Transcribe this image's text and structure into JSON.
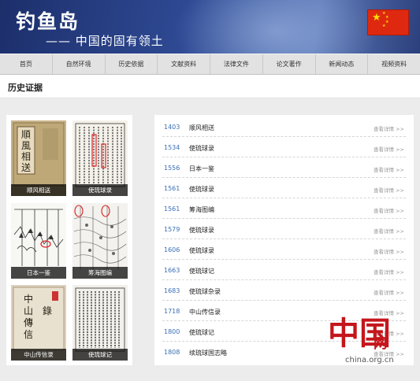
{
  "header": {
    "title": "钓鱼岛",
    "subtitle": "—— 中国的固有领土",
    "flag_icon": "china-flag"
  },
  "nav": [
    "首页",
    "自然环境",
    "历史依据",
    "文献资料",
    "法律文件",
    "论文著作",
    "新闻动态",
    "视频资料"
  ],
  "section": {
    "title": "历史证据"
  },
  "gallery": [
    {
      "caption": "顺风相送"
    },
    {
      "caption": "使琉球录"
    },
    {
      "caption": "日本一鉴"
    },
    {
      "caption": "筹海图编"
    },
    {
      "caption": "中山传信录"
    },
    {
      "caption": "使琉球记"
    }
  ],
  "records": [
    {
      "year": "1403",
      "title": "顺风相送",
      "more": "查看详情 >>"
    },
    {
      "year": "1534",
      "title": "使琉球录",
      "more": "查看详情 >>"
    },
    {
      "year": "1556",
      "title": "日本一鉴",
      "more": "查看详情 >>"
    },
    {
      "year": "1561",
      "title": "使琉球录",
      "more": "查看详情 >>"
    },
    {
      "year": "1561",
      "title": "筹海图编",
      "more": "查看详情 >>"
    },
    {
      "year": "1579",
      "title": "使琉球录",
      "more": "查看详情 >>"
    },
    {
      "year": "1606",
      "title": "使琉球录",
      "more": "查看详情 >>"
    },
    {
      "year": "1663",
      "title": "使琉球记",
      "more": "查看详情 >>"
    },
    {
      "year": "1683",
      "title": "使琉球杂录",
      "more": "查看详情 >>"
    },
    {
      "year": "1718",
      "title": "中山传信录",
      "more": "查看详情 >>"
    },
    {
      "year": "1800",
      "title": "使琉球记",
      "more": "查看详情 >>"
    },
    {
      "year": "1808",
      "title": "续琉球国志略",
      "more": "查看详情 >>"
    }
  ],
  "logo": {
    "mark": "中国",
    "net": "网",
    "url": "china.org.cn"
  },
  "colors": {
    "banner": "#2f4a94",
    "flag_red": "#de2910",
    "flag_star": "#ffde00",
    "year_link": "#3a6fb5",
    "logo_red": "#c4161c"
  }
}
